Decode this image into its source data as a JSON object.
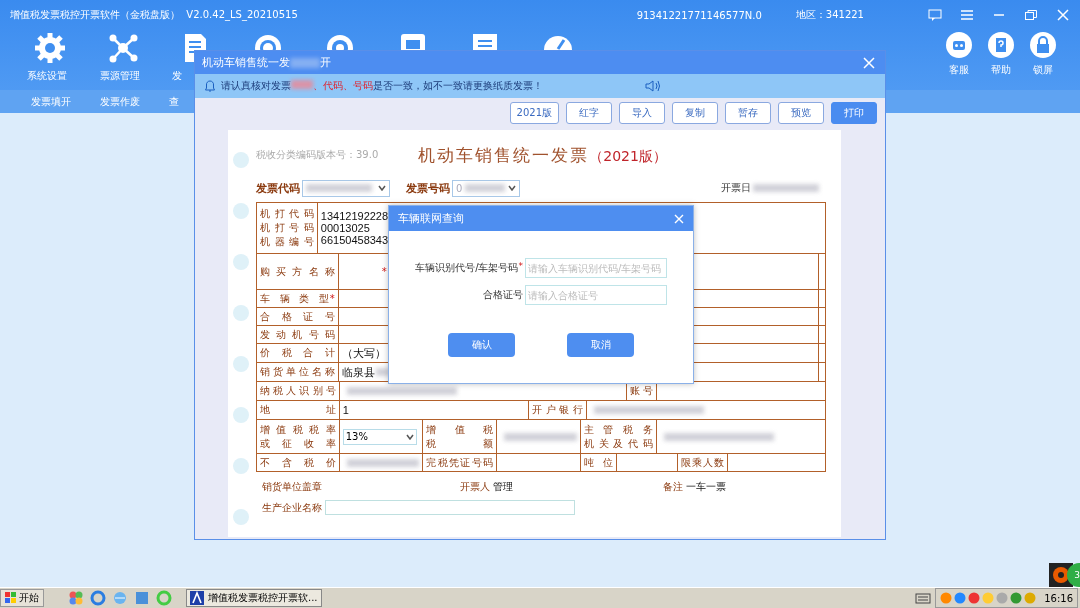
{
  "app": {
    "title": "增值税发票税控开票软件（金税盘版）  V2.0.42_LS_20210515",
    "tax_id": "91341221771146577N.0",
    "region": "地区：341221"
  },
  "toolbar": [
    "系统设置",
    "票源管理",
    "发"
  ],
  "right_tools": [
    "客服",
    "帮助",
    "锁屏"
  ],
  "nav_tabs": [
    "发票填开",
    "发票作废",
    "查"
  ],
  "dialog": {
    "title": "机动车销售统一发",
    "title_end": "开",
    "notice": [
      {
        "kind": "text",
        "text": "请认真核对发票"
      },
      {
        "kind": "blurred"
      },
      {
        "kind": "alert",
        "text": "、代码、号码"
      },
      {
        "kind": "text",
        "text": "是否一致，如不一致请更换纸质发票！"
      }
    ],
    "buttons": [
      {
        "label": "2021版",
        "primary": false
      },
      {
        "label": "红字",
        "primary": false
      },
      {
        "label": "导入",
        "primary": false
      },
      {
        "label": "复制",
        "primary": false
      },
      {
        "label": "暂存",
        "primary": false
      },
      {
        "label": "预览",
        "primary": false
      },
      {
        "label": "打印",
        "primary": true
      }
    ]
  },
  "invoice": {
    "version_note": "税收分类编码版本号：39.0",
    "title": "机动车销售统一发票",
    "edition": "（2021版）",
    "code_label": "发票代码",
    "number_label": "发票号码",
    "number_value": "0",
    "date_label": "开票日",
    "rows": [
      {
        "cells": [
          {
            "kind": "label3",
            "lines": [
              "机打代码",
              "机打号码",
              "机器编号"
            ]
          },
          {
            "kind": "value3",
            "lines": [
              "13412192228",
              "00013025",
              "66150458343"
            ]
          }
        ]
      },
      {
        "cells": [
          {
            "kind": "label",
            "text": "购买方名称"
          },
          {
            "kind": "value",
            "required_mark": "*"
          },
          {
            "kind": "value"
          }
        ]
      },
      {
        "cells": [
          {
            "kind": "label",
            "text": "车辆类型",
            "required_mark": "*"
          },
          {
            "kind": "value"
          },
          {
            "kind": "value"
          }
        ]
      },
      {
        "cells": [
          {
            "kind": "label",
            "text": "合格证号"
          },
          {
            "kind": "value"
          },
          {
            "kind": "value"
          }
        ]
      },
      {
        "cells": [
          {
            "kind": "label",
            "text": "发动机号码"
          },
          {
            "kind": "value"
          },
          {
            "kind": "value"
          }
        ]
      },
      {
        "cells": [
          {
            "kind": "label",
            "text": "价税合计"
          },
          {
            "kind": "value",
            "text": "（大写）"
          },
          {
            "kind": "value"
          }
        ]
      },
      {
        "cells": [
          {
            "kind": "label",
            "text": "销货单位名称"
          },
          {
            "kind": "value",
            "text": "临泉县",
            "blurred": true
          },
          {
            "kind": "value"
          }
        ]
      },
      {
        "cells": [
          {
            "kind": "label",
            "text": "纳税人识别号"
          },
          {
            "kind": "value",
            "blurred": true
          },
          {
            "kind": "label",
            "text": "账号"
          },
          {
            "kind": "value"
          }
        ]
      },
      {
        "cells": [
          {
            "kind": "label",
            "text": "地址"
          },
          {
            "kind": "value",
            "text": "1"
          },
          {
            "kind": "label",
            "text": "开户银行"
          },
          {
            "kind": "value",
            "blurred": true
          }
        ]
      },
      {
        "cells": [
          {
            "kind": "label2",
            "lines": [
              "增值税税率",
              "或征收率"
            ]
          },
          {
            "kind": "select",
            "text": "13%"
          },
          {
            "kind": "label2",
            "lines": [
              "增值税",
              "税额"
            ]
          },
          {
            "kind": "value",
            "blurred": true
          },
          {
            "kind": "label2",
            "lines": [
              "主管税务",
              "机关及代码"
            ]
          },
          {
            "kind": "value",
            "blurred": true
          }
        ]
      },
      {
        "cells": [
          {
            "kind": "label",
            "text": "不含税价"
          },
          {
            "kind": "value",
            "blurred": true
          },
          {
            "kind": "label",
            "text": "完税凭证号码"
          },
          {
            "kind": "value"
          },
          {
            "kind": "label",
            "text": "吨位"
          },
          {
            "kind": "value"
          },
          {
            "kind": "label",
            "text": "限乘人数"
          },
          {
            "kind": "value"
          }
        ]
      }
    ],
    "seal_label": "销货单位盖章",
    "issuer_label": "开票人",
    "issuer": "管理",
    "remark_label": "备注",
    "remark": "一车一票",
    "maker_label": "生产企业名称"
  },
  "modal": {
    "title": "车辆联网查询",
    "fields": [
      {
        "label": "车辆识别代号/车架号码",
        "required_mark": "*",
        "placeholder": "请输入车辆识别代码/车架号码"
      },
      {
        "label": "合格证号",
        "placeholder": "请输入合格证号"
      }
    ],
    "buttons": [
      "确认",
      "取消"
    ]
  },
  "taskbar": {
    "start": "开始",
    "task": "增值税发票税控开票软...",
    "clock": "16:16"
  },
  "badge": "3"
}
